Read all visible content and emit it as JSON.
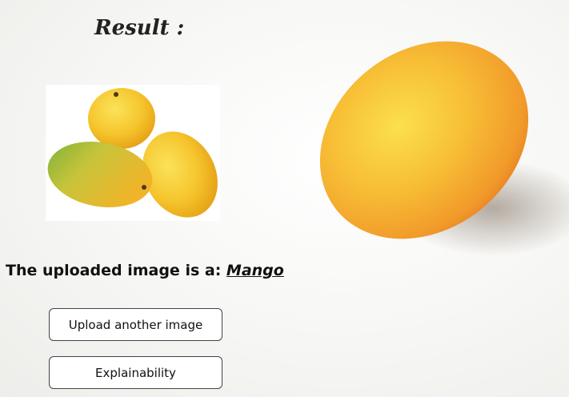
{
  "header": {
    "title": "Result :"
  },
  "result": {
    "prefix": "The uploaded image is a: ",
    "label": "Mango"
  },
  "buttons": {
    "upload_another": "Upload another image",
    "explainability": "Explainability"
  },
  "colors": {
    "text": "#111111",
    "button_border": "#444444",
    "mango_orange": "#f39c2e",
    "mango_yellow": "#f6c93a",
    "mango_green": "#8cb83a"
  },
  "images": {
    "uploaded_image": "three-mangoes-photo",
    "background_image": "single-mango-photo"
  }
}
